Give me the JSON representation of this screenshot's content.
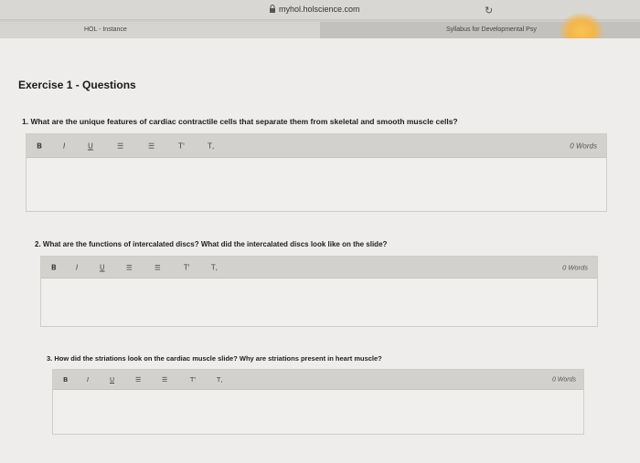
{
  "browser": {
    "url": "myhol.holscience.com",
    "tabs": [
      {
        "label": "HOL - Instance"
      },
      {
        "label": "Syllabus for Developmental Psy"
      }
    ]
  },
  "page": {
    "title": "Exercise 1 - Questions",
    "toolbar": {
      "bold": "B",
      "italic": "I",
      "underline": "U",
      "bullet_list": "☰",
      "numbered_list": "☰",
      "superscript": "T'",
      "subscript": "T,"
    },
    "questions": [
      {
        "text": "1. What are the unique features of cardiac contractile cells that separate them from skeletal and smooth muscle cells?",
        "word_count": "0 Words"
      },
      {
        "text": "2. What are the functions of intercalated discs? What did the intercalated discs look like on the slide?",
        "word_count": "0 Words"
      },
      {
        "text": "3. How did the striations look on the cardiac muscle slide? Why are striations present in heart muscle?",
        "word_count": "0 Words"
      }
    ]
  }
}
